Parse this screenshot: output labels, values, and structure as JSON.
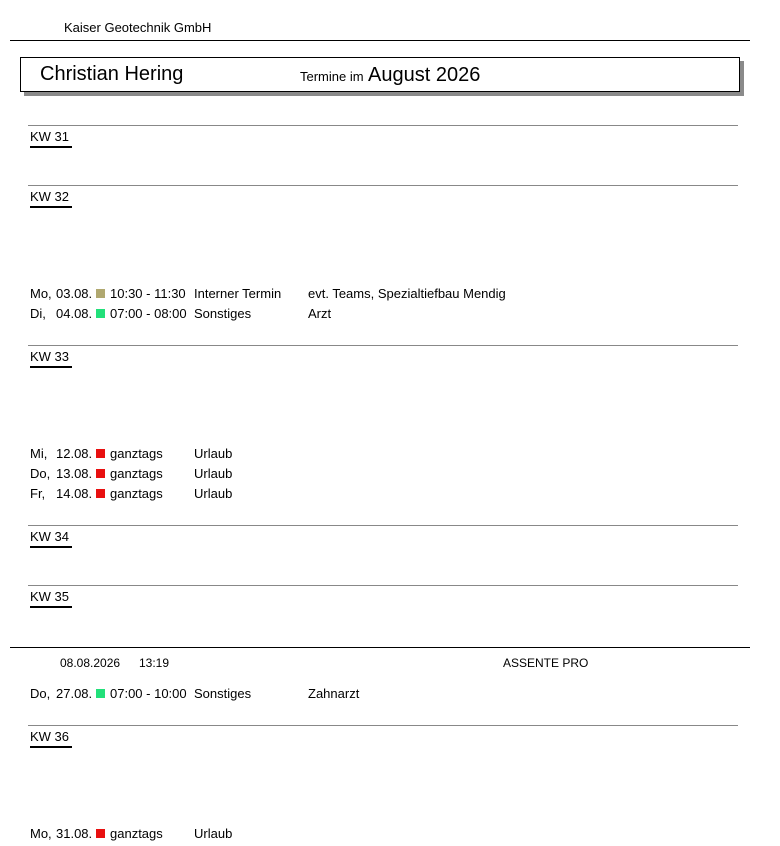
{
  "header": {
    "company": "Kaiser Geotechnik GmbH",
    "person": "Christian Hering",
    "termine_label": "Termine im",
    "month": "August 2026"
  },
  "weeks": [
    {
      "label": "KW 31",
      "entries": []
    },
    {
      "label": "KW 32",
      "entries": [
        {
          "day": "Mo,",
          "date": "03.08.",
          "color": "#b0a870",
          "time": "10:30 - 11:30",
          "type": "Interner Termin",
          "desc": "evt. Teams, Spezialtiefbau Mendig"
        },
        {
          "day": "Di,",
          "date": "04.08.",
          "color": "#22e07a",
          "time": "07:00 - 08:00",
          "type": "Sonstiges",
          "desc": "Arzt"
        }
      ]
    },
    {
      "label": "KW 33",
      "entries": [
        {
          "day": "Mi,",
          "date": "12.08.",
          "color": "#e81010",
          "time": "ganztags",
          "type": "Urlaub",
          "desc": ""
        },
        {
          "day": "Do,",
          "date": "13.08.",
          "color": "#e81010",
          "time": "ganztags",
          "type": "Urlaub",
          "desc": ""
        },
        {
          "day": "Fr,",
          "date": "14.08.",
          "color": "#e81010",
          "time": "ganztags",
          "type": "Urlaub",
          "desc": ""
        }
      ]
    },
    {
      "label": "KW 34",
      "entries": []
    },
    {
      "label": "KW 35",
      "entries": [
        {
          "day": "Do,",
          "date": "27.08.",
          "color": "#22e07a",
          "time": "07:00 - 10:00",
          "type": "Sonstiges",
          "desc": "Zahnarzt"
        }
      ]
    },
    {
      "label": "KW 36",
      "entries": [
        {
          "day": "Mo,",
          "date": "31.08.",
          "color": "#e81010",
          "time": "ganztags",
          "type": "Urlaub",
          "desc": ""
        }
      ]
    }
  ],
  "footer": {
    "date": "08.08.2026",
    "time": "13:19",
    "app": "ASSENTE PRO"
  }
}
